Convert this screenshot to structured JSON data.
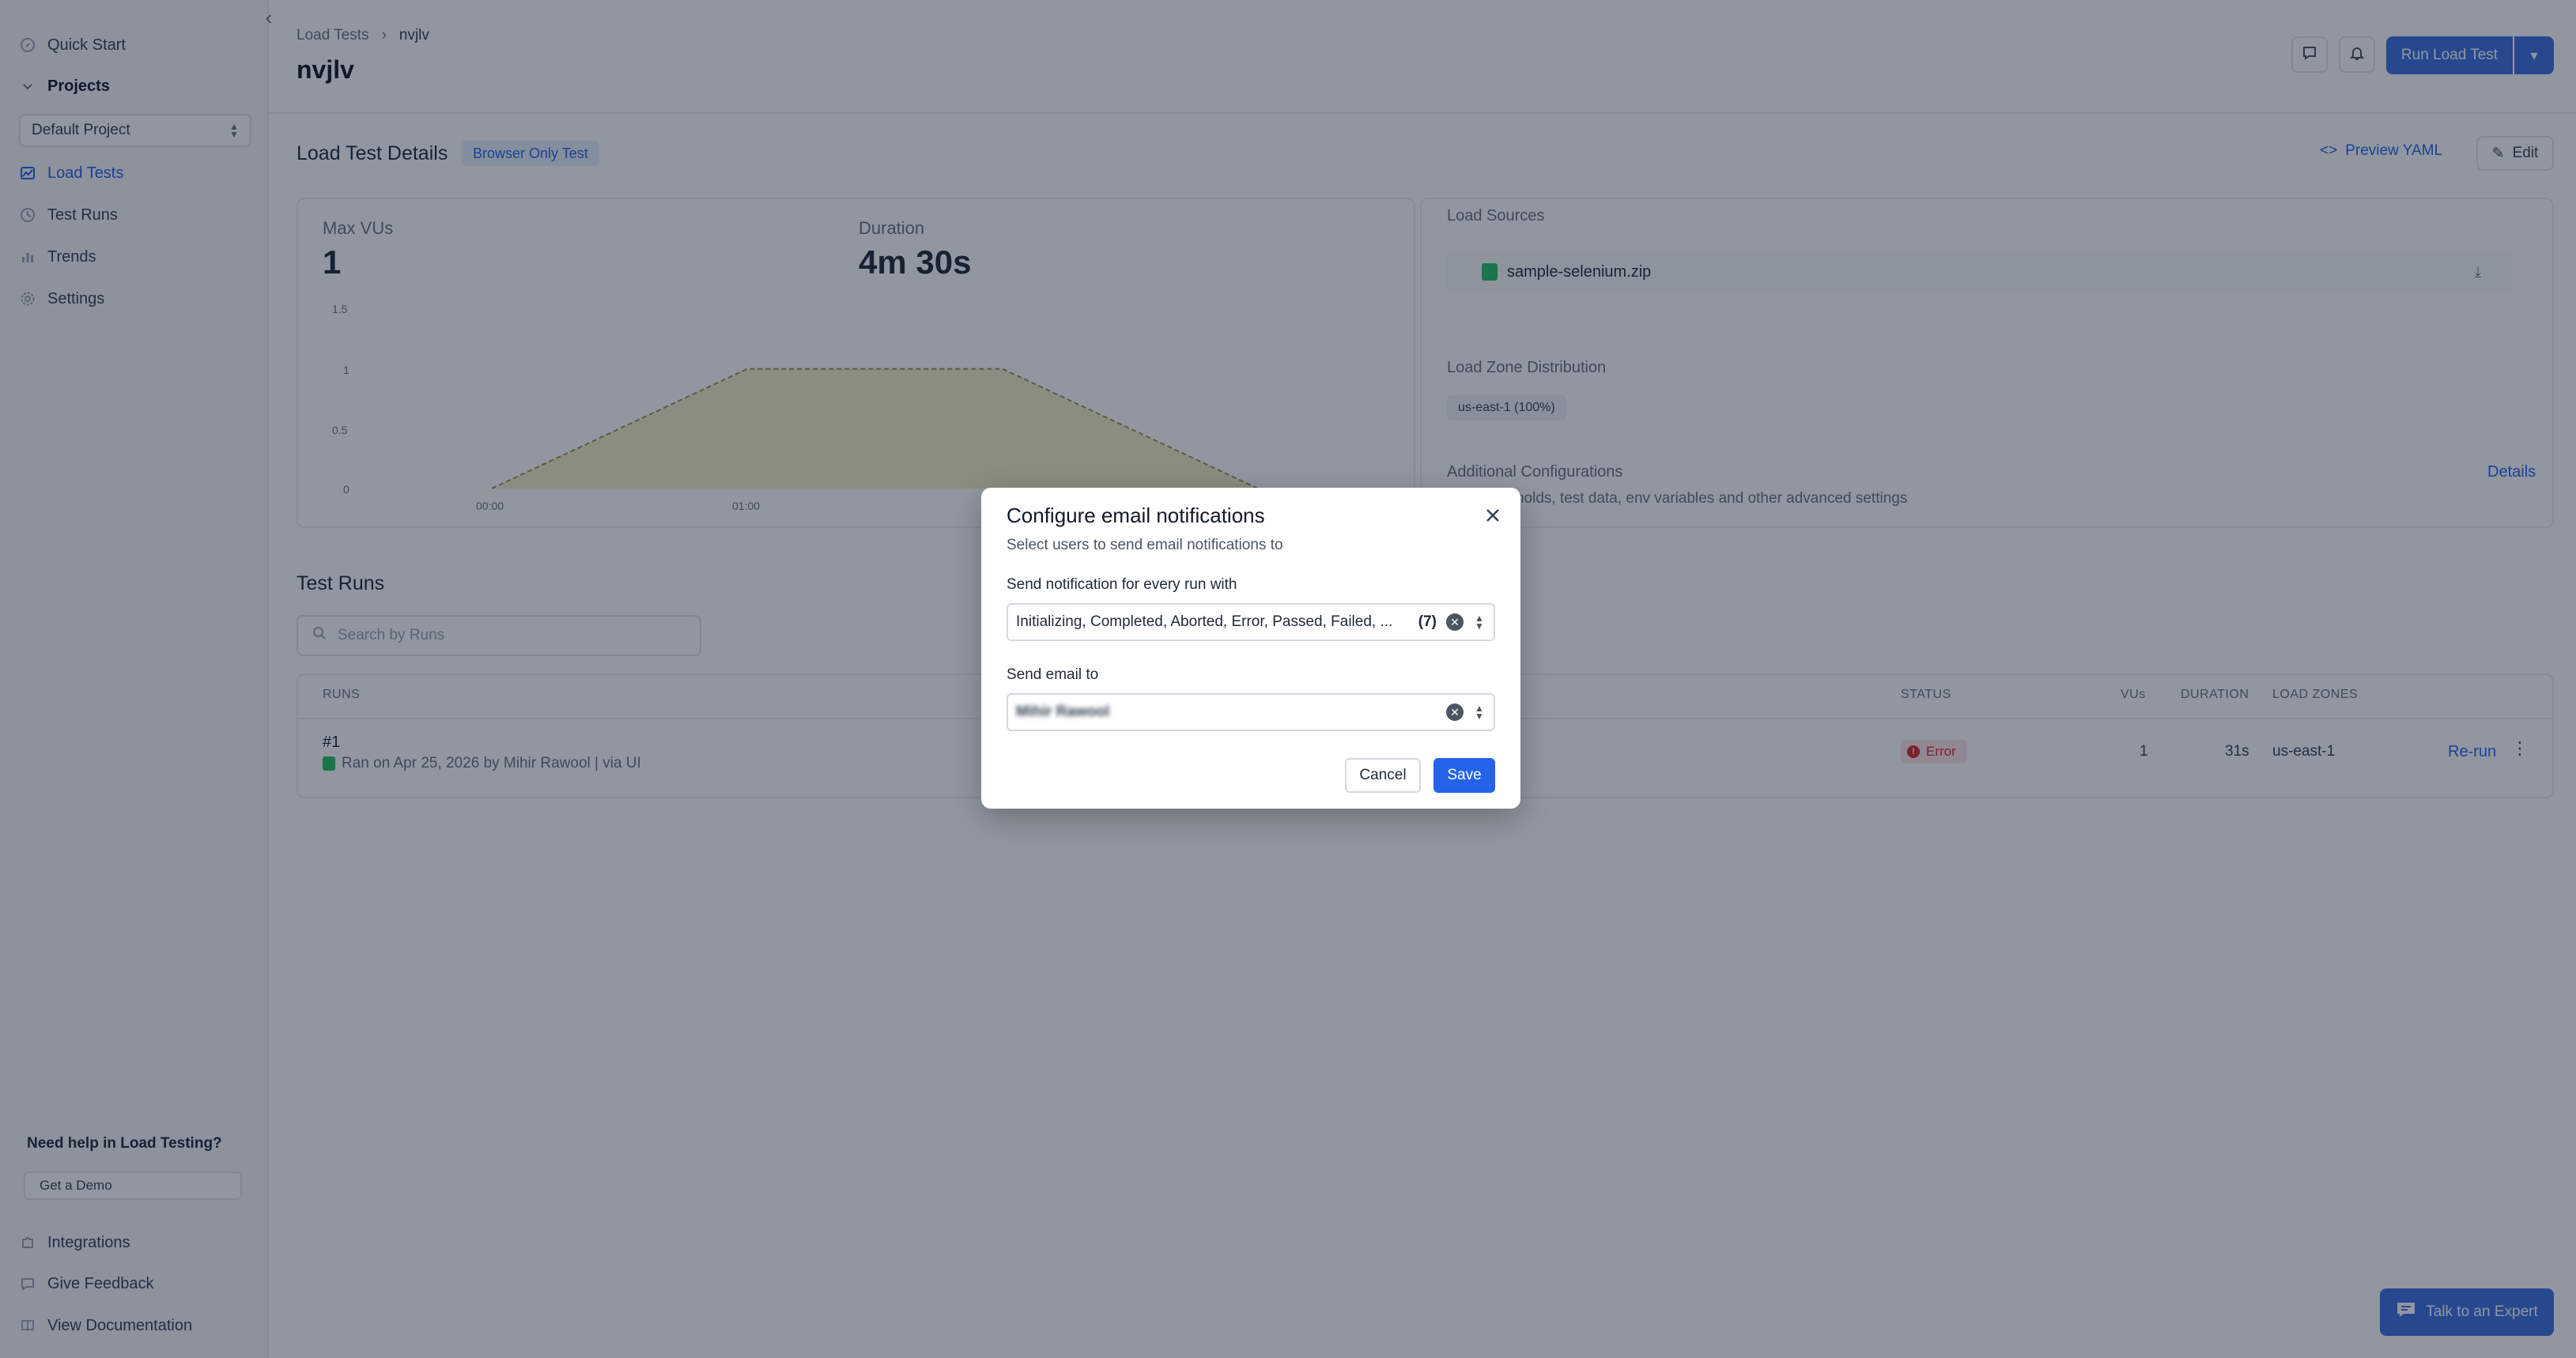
{
  "sidebar": {
    "quick_start": "Quick Start",
    "projects": "Projects",
    "project_select": "Default Project",
    "items": [
      {
        "label": "Load Tests"
      },
      {
        "label": "Test Runs"
      },
      {
        "label": "Trends"
      },
      {
        "label": "Settings"
      }
    ],
    "help_title": "Need help in Load Testing?",
    "demo_button": "Get a Demo",
    "bottom": [
      {
        "label": "Integrations"
      },
      {
        "label": "Give Feedback"
      },
      {
        "label": "View Documentation"
      }
    ]
  },
  "header": {
    "breadcrumb": [
      "Load Tests",
      "nvjlv"
    ],
    "title": "nvjlv",
    "run_button": "Run Load Test"
  },
  "details": {
    "title": "Load Test Details",
    "badge": "Browser Only Test",
    "preview_yaml": "Preview YAML",
    "edit": "Edit",
    "max_vus_label": "Max VUs",
    "max_vus_value": "1",
    "duration_label": "Duration",
    "duration_value": "4m 30s",
    "load_sources_label": "Load Sources",
    "load_source_file": "sample-selenium.zip",
    "zone_label": "Load Zone Distribution",
    "zone_value": "us-east-1 (100%)",
    "additional_label": "Additional Configurations",
    "additional_desc": "hresholds, test data, env variables and other advanced settings",
    "details_link": "Details"
  },
  "chart_data": {
    "type": "area",
    "x": [
      "00:00",
      "01:00"
    ],
    "y_ticks": [
      "1.5",
      "1",
      "0.5",
      "0"
    ],
    "ylim": [
      0,
      1.5
    ],
    "points": [
      [
        0,
        0
      ],
      [
        1,
        1
      ],
      [
        2,
        1
      ],
      [
        3,
        0
      ]
    ]
  },
  "runs": {
    "title": "Test Runs",
    "search_placeholder": "Search by Runs",
    "columns": [
      "RUNS",
      "STATUS",
      "VUs",
      "DURATION",
      "LOAD ZONES"
    ],
    "rows": [
      {
        "id": "#1",
        "meta": "Ran on Apr 25, 2026 by Mihir Rawool | via UI",
        "status": "Error",
        "vus": "1",
        "duration": "31s",
        "zone": "us-east-1",
        "action": "Re-run"
      }
    ]
  },
  "expert_button": "Talk to an Expert",
  "modal": {
    "title": "Configure email notifications",
    "subtitle": "Select users to send email notifications to",
    "status_label": "Send notification for every run with",
    "status_value": "Initializing, Completed, Aborted, Error, Passed, Failed, ...",
    "status_count": "(7)",
    "email_label": "Send email to",
    "email_value": "Mihir Rawool",
    "cancel": "Cancel",
    "save": "Save"
  },
  "colors": {
    "accent": "#2563eb",
    "error": "#dc2626",
    "chart_fill": "#f3efc4",
    "chart_line": "#9a9650"
  }
}
